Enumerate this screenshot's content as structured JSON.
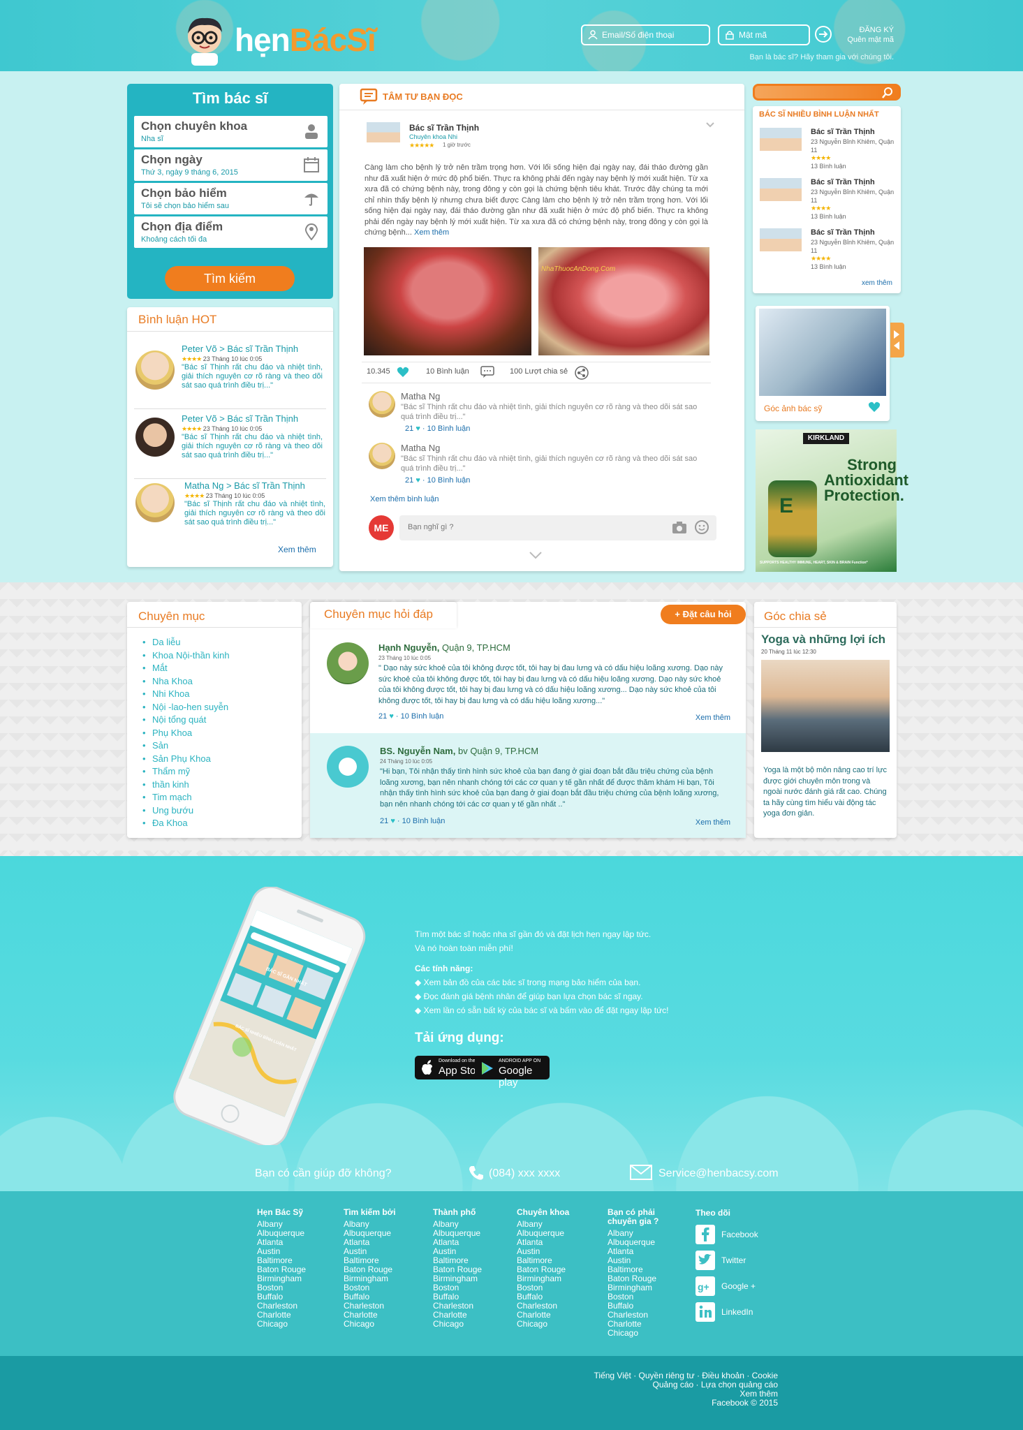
{
  "header": {
    "logo_a": "hẹn",
    "logo_b": "BácSĩ",
    "email_placeholder": "Email/Số điện thoại",
    "password_placeholder": "Mật mã",
    "register": "ĐĂNG KÝ",
    "forgot": "Quên mật mã",
    "doctor_q": "Bạn là bác sĩ?",
    "doctor_join": "Hãy tham gia với chúng tôi."
  },
  "search": {
    "title": "Tìm bác sĩ",
    "fields": [
      {
        "label": "Chọn chuyên khoa",
        "value": "Nha sĩ"
      },
      {
        "label": "Chọn ngày",
        "value": "Thứ 3, ngày 9 tháng 6, 2015"
      },
      {
        "label": "Chọn bảo hiểm",
        "value": "Tôi sẽ chọn bảo hiểm sau"
      },
      {
        "label": "Chọn địa điểm",
        "value": "Khoảng cách tối đa"
      }
    ],
    "button": "Tìm kiếm"
  },
  "hot": {
    "title": "Bình luận HOT",
    "items": [
      {
        "name": "Peter Võ > Bác sĩ Trần Thịnh",
        "date": "23 Tháng 10 lúc 0:05",
        "text": "\"Bác sĩ Thịnh rất chu đáo và nhiệt tình, giải thích nguyên cơ rõ ràng và theo dõi sát sao quá trình điều trị...\""
      },
      {
        "name": "Peter Võ > Bác sĩ Trần Thịnh",
        "date": "23 Tháng 10 lúc 0:05",
        "text": "\"Bác sĩ Thịnh rất chu đáo và nhiệt tình, giải thích nguyên cơ rõ ràng và theo dõi sát sao quá trình điều trị...\""
      },
      {
        "name": "Matha Ng > Bác sĩ Trần Thịnh",
        "date": "23 Tháng 10 lúc 0:05",
        "text": "\"Bác sĩ Thịnh rất chu đáo và nhiệt tình, giải thích nguyên cơ rõ ràng và theo dõi sát sao quá trình điều trị...\""
      }
    ],
    "see_more": "Xem thêm"
  },
  "feed": {
    "title": "TÂM TƯ BẠN ĐỌC",
    "author": "Bác sĩ Trần Thịnh",
    "specialty": "Chuyên khoa Nhi",
    "time": "1 giờ trước",
    "body": "Càng làm cho bệnh lý trở nên trầm trọng hơn. Với lối sống hiện đại ngày nay, đái tháo đường gần như đã xuất hiện ở mức độ phổ biến. Thực ra không phải đến ngày nay bệnh lý mới xuất hiện. Từ xa xưa đã có chứng bệnh này, trong đông y còn gọi là chứng bệnh tiêu khát. Trước đây chúng ta mới chỉ nhìn thấy bệnh lý nhưng chưa biết được Càng làm cho bệnh lý trở nên trầm trọng hơn. Với lối sống hiện đại ngày nay, đái tháo đường gần như đã xuất hiện ở mức độ phổ biến. Thực ra không phải đến ngày nay bệnh lý mới xuất hiện. Từ xa xưa đã có chứng bệnh này, trong đông y còn gọi là chứng bệnh...",
    "read_more": "Xem thêm",
    "image_caption": "NhaThuocAnDong.Com",
    "likes": "10.345",
    "comments": "10 Bình luận",
    "shares": "100 Lượt chia sẻ",
    "comment_items": [
      {
        "name": "Matha Ng",
        "text": "\"Bác sĩ Thịnh rất chu đáo và nhiệt tình, giải thích nguyên cơ rõ ràng và theo dõi sát sao quá trình điều trị...\"",
        "likes": "21",
        "replies": "10 Bình luận"
      },
      {
        "name": "Matha Ng",
        "text": "\"Bác sĩ Thịnh rất chu đáo và nhiệt tình, giải thích nguyên cơ rõ ràng và theo dõi sát sao quá trình điều trị...\"",
        "likes": "21",
        "replies": "10 Bình luận"
      }
    ],
    "more_comments": "Xem thêm bình luận",
    "me": "ME",
    "input_placeholder": "Bạn nghĩ gì ?"
  },
  "topdocs": {
    "title": "BÁC SĨ NHIỀU BÌNH LUẬN NHẤT",
    "items": [
      {
        "name": "Bác sĩ Trần Thịnh",
        "address": "23 Nguyễn Bỉnh Khiêm, Quận 11",
        "comments": "13 Bình luận"
      },
      {
        "name": "Bác sĩ Trần Thịnh",
        "address": "23 Nguyễn Bỉnh Khiêm, Quận 11",
        "comments": "13 Bình luận"
      },
      {
        "name": "Bác sĩ Trần Thịnh",
        "address": "23 Nguyễn Bỉnh Khiêm, Quận 11",
        "comments": "13 Bình luận"
      }
    ],
    "see_more": "xem thêm"
  },
  "gallery": {
    "caption": "Góc ảnh bác sỹ"
  },
  "ad": {
    "brand": "KIRKLAND",
    "headline": "Strong Antioxidant Protection.",
    "bottle": "E",
    "footer": "SUPPORTS HEALTHY IMMUNE, HEART, SKIN & BRAIN Function*"
  },
  "categories": {
    "title": "Chuyên mục",
    "items": [
      "Da liễu",
      "Khoa Nội-thần kinh",
      "Mắt",
      "Nha Khoa",
      "Nhi Khoa",
      "Nội -lao-hen suyễn",
      "Nội tổng quát",
      "Phụ Khoa",
      "Sản",
      "Sản Phụ Khoa",
      "Thẩm mỹ",
      "thần kinh",
      "Tim mạch",
      "Ung bướu",
      "Đa Khoa"
    ]
  },
  "qa": {
    "title": "Chuyên mục hỏi đáp",
    "ask": "+ Đặt câu hỏi",
    "items": [
      {
        "name": "Hạnh Nguyễn,",
        "loc": " Quận 9, TP.HCM",
        "date": "23 Tháng 10 lúc 0:05",
        "text": "\" Dạo này sức khoẻ của tôi không được tốt, tôi hay bị đau lưng và có dấu hiệu loãng xương. Dạo này sức khoẻ của tôi không được tốt, tôi hay bị đau lưng và có dấu hiệu loãng xương. Dạo này sức khoẻ của tôi không được tốt, tôi hay bị đau lưng và có dấu hiệu loãng xương... Dạo này sức khoẻ của tôi không được tốt, tôi hay bị đau lưng và có dấu hiệu loãng xương...\"",
        "likes": "21",
        "comments": "10 Bình luận",
        "more": "Xem thêm"
      },
      {
        "name": "BS. Nguyễn Nam,",
        "loc": " bv Quận 9, TP.HCM",
        "date": "24 Tháng 10 lúc 0:05",
        "text": "\"Hi bạn, Tôi nhận thấy tình hình sức khoẻ của bạn đang ở giai đoạn bắt đầu triệu chứng của bệnh loãng xương, bạn nên nhanh chóng tới các cơ quan y tế gần nhất để được thăm khám Hi bạn, Tôi nhận thấy tình hình sức khoẻ của bạn đang ở giai đoạn bắt đầu triệu chứng của bệnh loãng xương, bạn nên nhanh chóng tới các cơ quan y tế gần nhất ..\"",
        "likes": "21",
        "comments": "10 Bình luận",
        "more": "Xem thêm"
      }
    ]
  },
  "share": {
    "title": "Góc chia sẻ",
    "headline": "Yoga và những lợi ích",
    "date": "20 Tháng 11 lúc 12:30",
    "text": "Yoga là một bộ môn nâng cao trí lực được giới chuyên môn trong và ngoài nước đánh giá rất cao. Chúng ta hãy cùng tìm hiểu vài động tác yoga đơn giản."
  },
  "app": {
    "line1": "Tìm một bác sĩ hoặc nha sĩ gần đó và đặt lịch hẹn ngay lập tức.",
    "line2": "Và nó hoàn toàn miễn phí!",
    "features_title": "Các tính năng:",
    "features": [
      "◆ Xem bản đồ của các bác sĩ trong mạng bảo hiểm của bạn.",
      "◆ Đọc đánh giá bệnh nhân để giúp bạn lựa chọn bác sĩ ngay.",
      "◆ Xem lần có sẵn bất kỳ của bác sĩ và bấm vào để đặt ngay lập tức!"
    ],
    "download_title": "Tải ứng dụng:",
    "appstore_small": "Download on the",
    "appstore": "App Store",
    "gplay_small": "ANDROID APP ON",
    "gplay": "Google play",
    "phone_near": "BÁC SĨ GẦN NHẤT",
    "phone_most": "BÁC SĨ NHIỀU BÌNH LUẬN NHẤT"
  },
  "help": {
    "question": "Bạn có cần giúp đỡ không?",
    "phone": "(084) xxx xxxx",
    "email": "Service@henbacsy.com"
  },
  "footer": {
    "columns": [
      {
        "title": "Hẹn Bác Sỹ",
        "items": [
          "Albany",
          "Albuquerque",
          "Atlanta",
          "Austin",
          "Baltimore",
          "Baton Rouge",
          "Birmingham",
          "Boston",
          "Buffalo",
          "Charleston",
          "Charlotte",
          "Chicago"
        ]
      },
      {
        "title": "Tìm kiếm bởi",
        "items": [
          "Albany",
          "Albuquerque",
          "Atlanta",
          "Austin",
          "Baltimore",
          "Baton Rouge",
          "Birmingham",
          "Boston",
          "Buffalo",
          "Charleston",
          "Charlotte",
          "Chicago"
        ]
      },
      {
        "title": "Thành phố",
        "items": [
          "Albany",
          "Albuquerque",
          "Atlanta",
          "Austin",
          "Baltimore",
          "Baton Rouge",
          "Birmingham",
          "Boston",
          "Buffalo",
          "Charleston",
          "Charlotte",
          "Chicago"
        ]
      },
      {
        "title": "Chuyên khoa",
        "items": [
          "Albany",
          "Albuquerque",
          "Atlanta",
          "Austin",
          "Baltimore",
          "Baton Rouge",
          "Birmingham",
          "Boston",
          "Buffalo",
          "Charleston",
          "Charlotte",
          "Chicago"
        ]
      },
      {
        "title": "Bạn có phải chuyên gia ?",
        "items": [
          "Albany",
          "Albuquerque",
          "Atlanta",
          "Austin",
          "Baltimore",
          "Baton Rouge",
          "Birmingham",
          "Boston",
          "Buffalo",
          "Charleston",
          "Charlotte",
          "Chicago"
        ]
      }
    ],
    "follow_title": "Theo dõi",
    "social": [
      "Facebook",
      "Twitter",
      "Google +",
      "LinkedIn"
    ],
    "legal": [
      "Tiếng Việt · Quyền riêng tư · Điều khoản · Cookie",
      "Quảng cáo · Lựa chọn quảng cáo",
      "Xem thêm",
      "Facebook © 2015"
    ]
  }
}
